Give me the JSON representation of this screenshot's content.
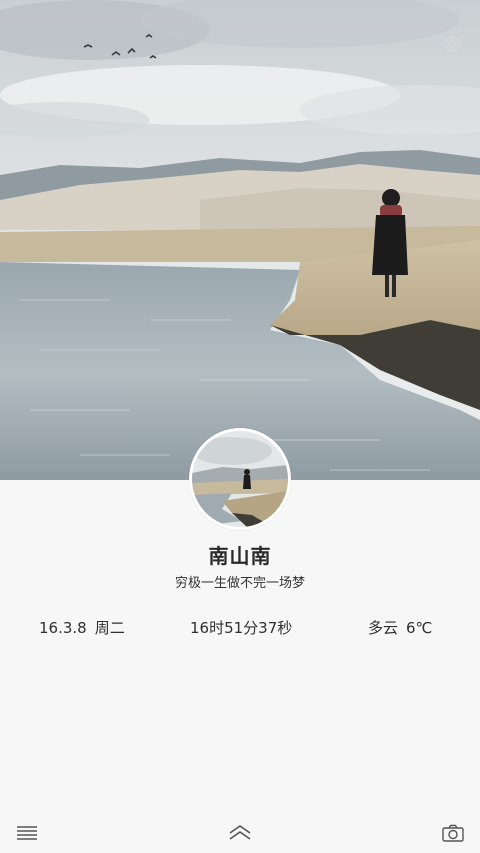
{
  "profile": {
    "name": "南山南",
    "motto": "穷极一生做不完一场梦"
  },
  "info": {
    "date": "16.3.8",
    "weekday": "周二",
    "time": "16时51分37秒",
    "weather": "多云",
    "temperature": "6℃"
  },
  "icons": {
    "settings": "gear-icon",
    "menu": "hamburger-menu-icon",
    "expand": "chevron-up-icon",
    "camera": "camera-icon"
  },
  "colors": {
    "background": "#f7f7f7",
    "text": "#2f2f2f",
    "icon": "#555555"
  }
}
